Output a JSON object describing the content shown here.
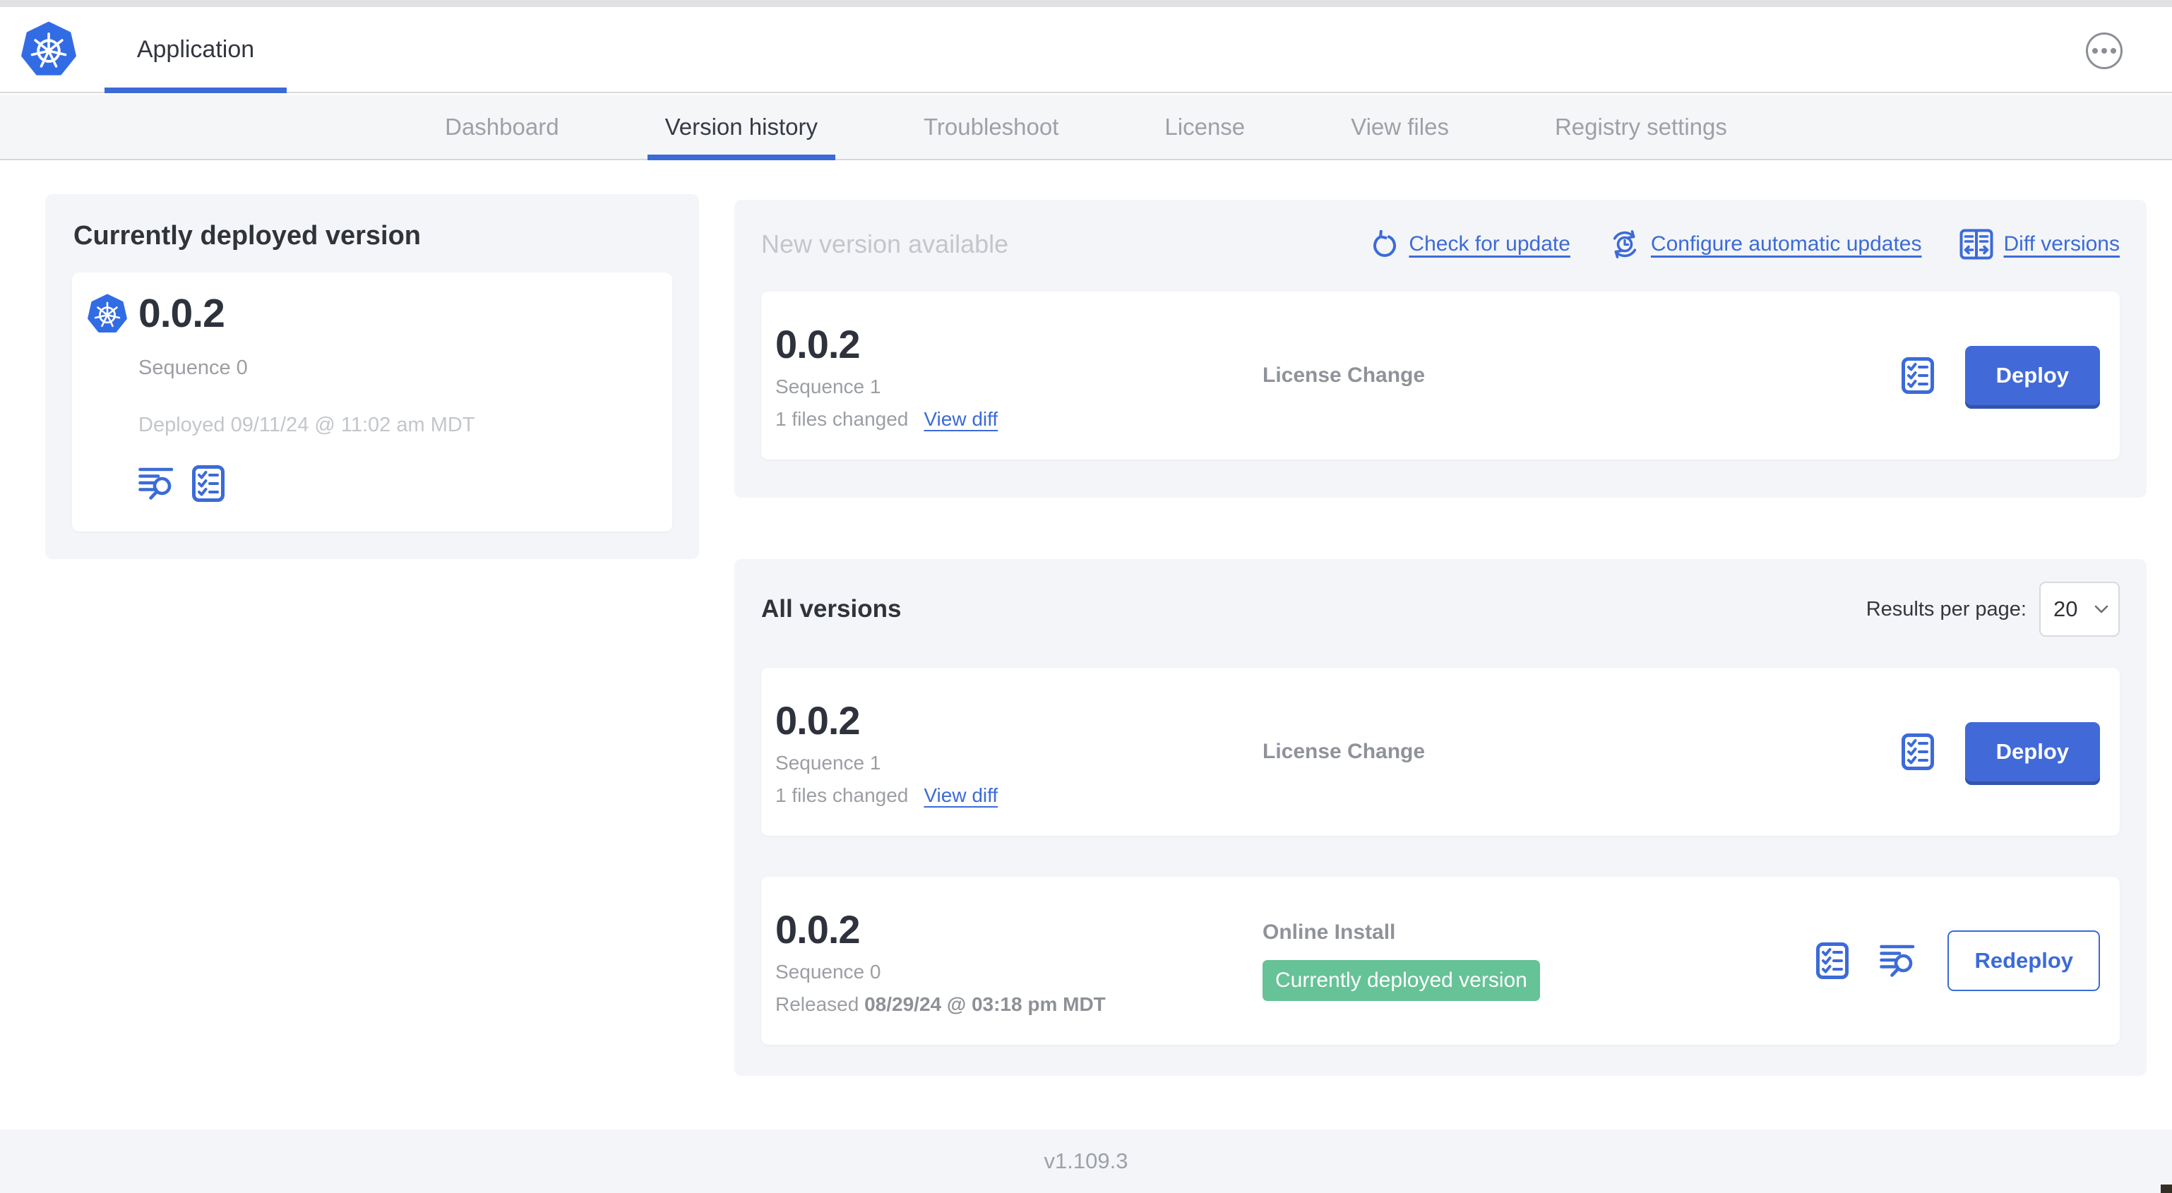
{
  "header": {
    "app_title": "Application"
  },
  "nav": {
    "active_tab": "Version history",
    "tabs": [
      {
        "label": "Dashboard"
      },
      {
        "label": "Version history"
      },
      {
        "label": "Troubleshoot"
      },
      {
        "label": "License"
      },
      {
        "label": "View files"
      },
      {
        "label": "Registry settings"
      }
    ]
  },
  "current_version_panel": {
    "title": "Currently deployed version",
    "version": "0.0.2",
    "sequence": "Sequence 0",
    "deployed": "Deployed 09/11/24 @ 11:02 am MDT"
  },
  "new_version_panel": {
    "title": "New version available",
    "check_for_update": "Check for update",
    "configure_automatic_updates": "Configure automatic updates",
    "diff_versions": "Diff versions",
    "card": {
      "version": "0.0.2",
      "sequence": "Sequence 1",
      "files_changed": "1 files changed",
      "view_diff": "View diff",
      "source": "License Change",
      "deploy_label": "Deploy"
    }
  },
  "all_versions_panel": {
    "title": "All versions",
    "results_per_page_label": "Results per page:",
    "results_per_page_value": "20",
    "rows": [
      {
        "version": "0.0.2",
        "sequence": "Sequence 1",
        "files_changed": "1 files changed",
        "view_diff": "View diff",
        "source": "License Change",
        "action_label": "Deploy"
      },
      {
        "version": "0.0.2",
        "sequence": "Sequence 0",
        "released_prefix": "Released",
        "released_date": "08/29/24 @ 03:18 pm MDT",
        "source": "Online Install",
        "badge": "Currently deployed version",
        "action_label": "Redeploy"
      }
    ]
  },
  "footer": {
    "version": "v1.109.3"
  },
  "icons": {
    "app_logo": "kubernetes-logo",
    "more": "ellipsis-icon",
    "check_update": "refresh-icon",
    "auto_updates": "clock-sync-icon",
    "diff": "diff-columns-icon",
    "logs": "view-logs-icon",
    "config": "checklist-icon",
    "select_caret": "chevron-down-icon"
  },
  "colors": {
    "accent_blue": "#3b6bd8",
    "button_blue": "#4169d8",
    "k8s_blue": "#326ce5",
    "badge_green": "#66c297",
    "panel_gray": "#f4f5f8"
  }
}
